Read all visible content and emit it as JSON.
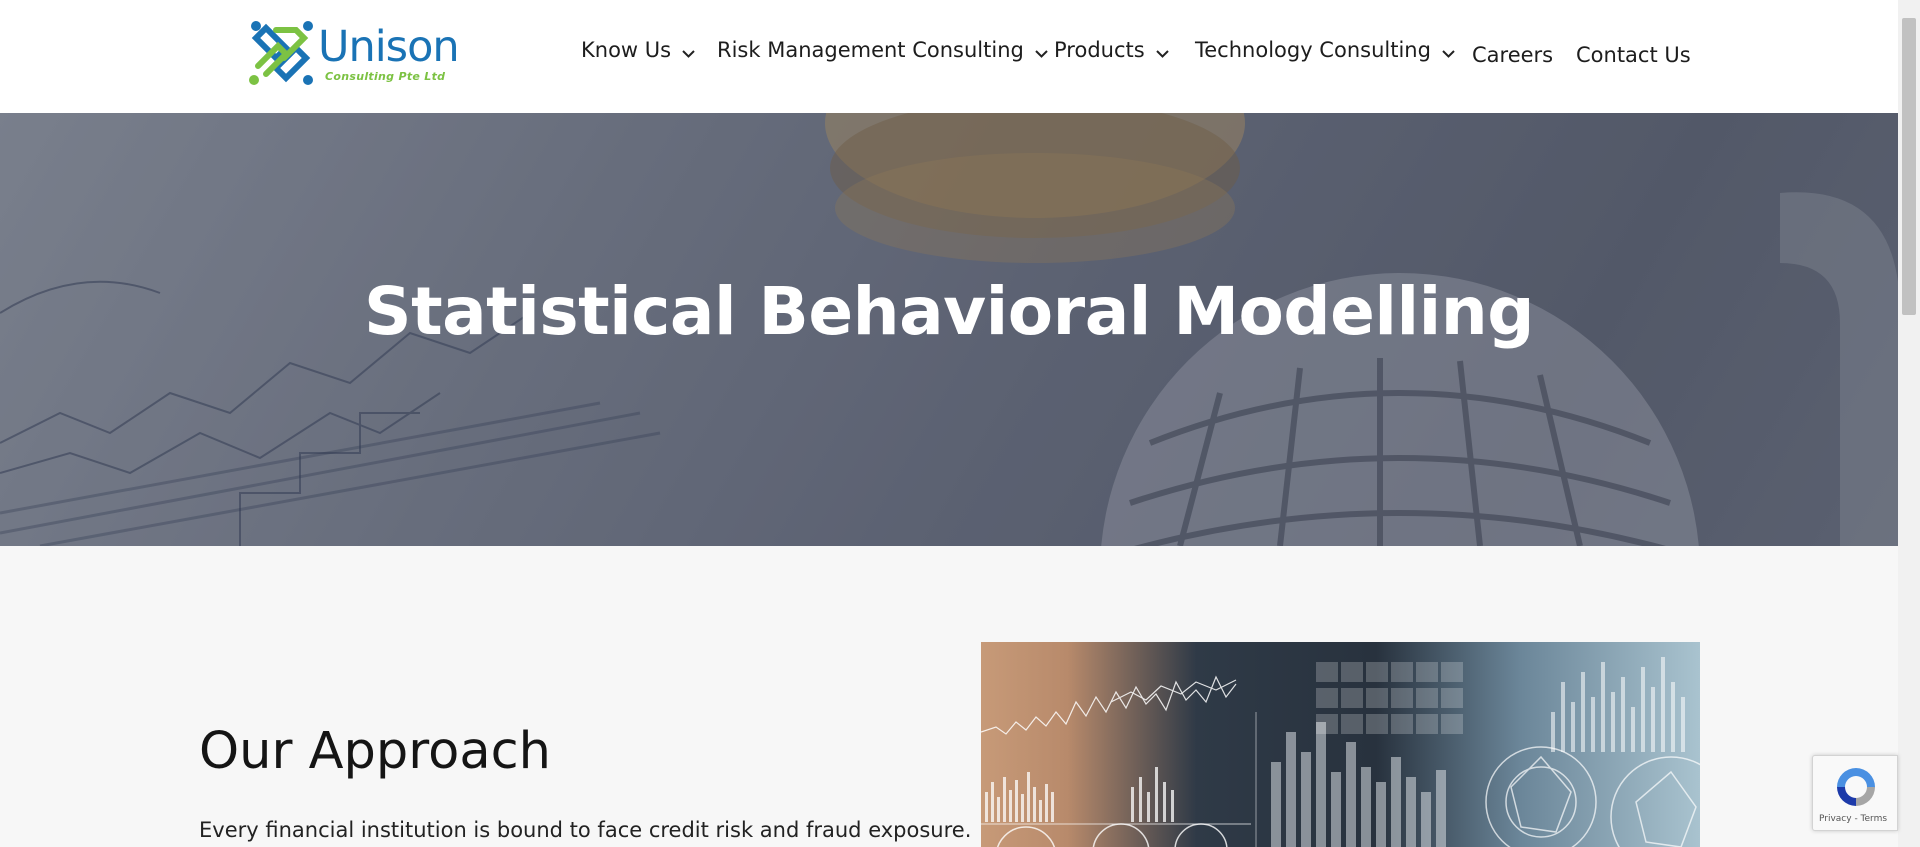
{
  "brand": {
    "name": "Unison",
    "tagline": "Consulting Pte Ltd",
    "colors": {
      "blue": "#1a73b5",
      "green": "#7cc243"
    }
  },
  "nav": {
    "items": [
      {
        "label": "Know Us",
        "dropdown": true
      },
      {
        "label": "Risk Management Consulting",
        "dropdown": true
      },
      {
        "label": "Products",
        "dropdown": true
      },
      {
        "label": "Technology Consulting",
        "dropdown": true
      },
      {
        "label": "Careers",
        "dropdown": false
      },
      {
        "label": "Contact Us",
        "dropdown": false
      }
    ]
  },
  "hero": {
    "title": "Statistical Behavioral Modelling"
  },
  "section": {
    "title": "Our Approach",
    "text": "Every financial institution is bound to face credit risk and fraud exposure."
  },
  "recaptcha": {
    "terms": "Privacy - Terms"
  }
}
